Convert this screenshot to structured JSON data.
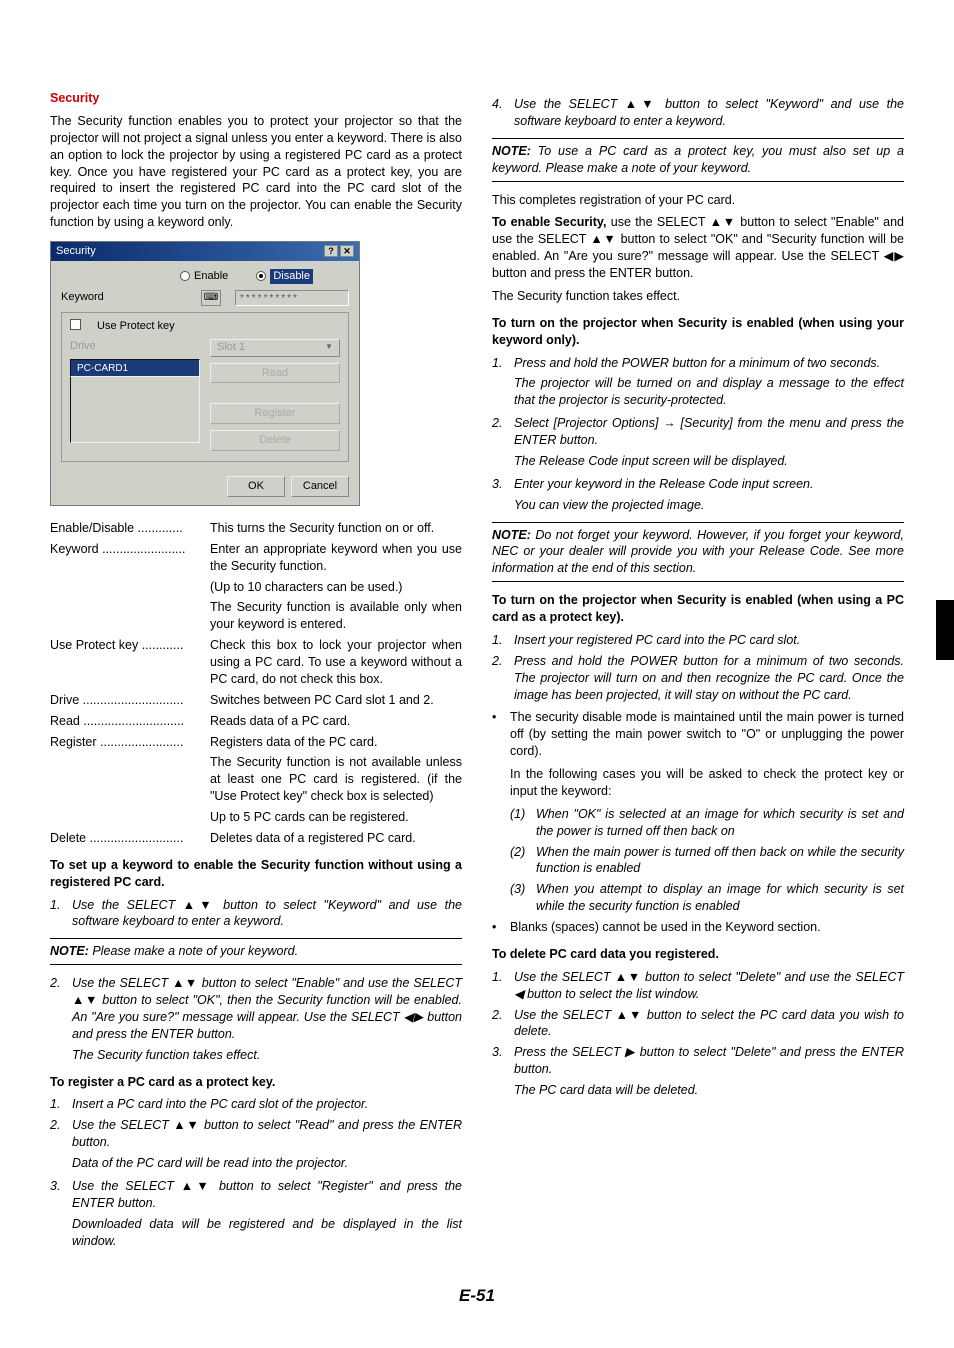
{
  "left": {
    "title": "Security",
    "intro": "The Security function enables you to protect your projector so that the projector will not project a signal unless you enter a keyword. There is also an option to lock the projector by using a registered PC card as a protect key. Once you have registered your PC card as a protect key, you are required to insert the registered PC card into the PC card slot of the projector each time you turn on the projector. You can enable the Security function by using a keyword only.",
    "dialog": {
      "title": "Security",
      "enable": "Enable",
      "disable": "Disable",
      "keyword": "Keyword",
      "kw_mask": "**********",
      "useprotect": "Use Protect key",
      "drive": "Drive",
      "slot": "Slot 1",
      "pccard": "PC-CARD1",
      "read": "Read",
      "register": "Register",
      "delete": "Delete",
      "ok": "OK",
      "cancel": "Cancel"
    },
    "defs": {
      "enable_t": "Enable/Disable .............",
      "enable_d": "This turns the Security function on or off.",
      "keyword_t": "Keyword ........................",
      "keyword_d": "Enter an appropriate keyword when you use the Security function.",
      "keyword_c1": "(Up to 10 characters can be used.)",
      "keyword_c2": "The Security function is available only when your keyword is entered.",
      "upk_t": "Use Protect key ............",
      "upk_d": "Check this box to lock your projector when using a PC card. To use a keyword without a PC card, do not check this box.",
      "drive_t": "Drive .............................",
      "drive_d": "Switches between PC Card slot 1 and 2.",
      "read_t": "Read .............................",
      "read_d": "Reads data of a PC card.",
      "reg_t": "Register ........................",
      "reg_d": "Registers data of the PC card.",
      "reg_c1": "The Security function is not available unless at least one PC card is registered. (if the \"Use Protect key\" check box is selected)",
      "reg_c2": "Up to 5 PC cards can be registered.",
      "del_t": "Delete ...........................",
      "del_d": "Deletes data of a registered PC card."
    },
    "setup_head": "To set up a keyword to enable the Security function without using a registered PC card.",
    "s1": "Use the SELECT ▲▼ button to select \"Keyword\" and use the software keyboard to enter a keyword.",
    "note1": "Please make a note of your keyword.",
    "s2a": "Use the SELECT ▲▼ button to select \"Enable\" and use the SELECT ▲▼ button to select \"OK\", then the Security function will be enabled. An \"Are you sure?\" message will appear. Use the SELECT ◀▶ button and press the ENTER button.",
    "s2b": "The Security function takes effect.",
    "reghead": "To register a PC card as a protect key.",
    "r1": "Insert a PC card into the PC card slot of the projector.",
    "r2": "Use the SELECT ▲▼ button to select \"Read\" and press the ENTER button.",
    "r2s": "Data of the PC card will be read into the projector.",
    "r3": "Use the SELECT ▲▼ button to select \"Register\" and press the ENTER button.",
    "r3s": "Downloaded data will be registered and be displayed in the list window."
  },
  "right": {
    "r4": "Use the SELECT ▲▼ button to select \"Keyword\" and use the software keyboard to enter a keyword.",
    "note2": "To use a PC card as a protect key, you must also set up a keyword. Please make a note of your keyword.",
    "completes": "This completes registration of your PC card.",
    "enable_para": "use the SELECT ▲▼ button and use the SELECT ▲▼ button to select \"OK\" and \"Security function will be enabled. An \"Are you sure?\" message will appear. Use the SELECT ◀▶ button and press the ENTER button.",
    "enable_lead": "To enable Security,",
    "enable_body1": " use the SELECT ▲▼ button to select \"Enable\" and use the SELECT ▲▼ button to select \"OK\" and \"Security function will be enabled. An \"Are you sure?\" message will appear. Use the SELECT ◀▶ button and press the ENTER button.",
    "enable_body2": "The Security function takes effect.",
    "turnon_kw_head": "To turn on the projector when Security is enabled (when using your keyword only).",
    "k1": "Press and hold the POWER button for a minimum of two seconds.",
    "k1s": "The projector will be turned on and display a message to the effect that the projector is security-protected.",
    "k2": "Select [Projector Options] → [Security] from the menu and press the ENTER button.",
    "k2s": "The Release Code input screen will be displayed.",
    "k3a": "Enter your keyword in the Release Code input screen.",
    "k3b": "You can view the projected image.",
    "note3": "Do not forget your keyword. However, if you forget your keyword, NEC or your dealer will provide you with your Release Code. See more information at the end of this section.",
    "turnon_pc_head": "To turn on the projector when Security is enabled (when using a PC card as a protect key).",
    "p1": "Insert your registered PC card into the PC card slot.",
    "p2": "Press and hold the POWER button for a minimum of two seconds. The projector will turn on and then recognize the PC card. Once the image has been projected, it will stay on without the PC card.",
    "b1": "The security disable mode is maintained until the main power is turned off (by setting the main power switch to \"O\" or unplugging the power cord).",
    "b1b": "In the following cases you will be asked to check the protect key or input the keyword:",
    "c1": "When \"OK\" is selected at an image for which security is set and the power is turned off then back on",
    "c2": "When the main power is turned off then back on while the security function is enabled",
    "c3": "When you attempt to display an image for which security is set while the security function is enabled",
    "b2": "Blanks (spaces) cannot be used in the Keyword section.",
    "delhead": "To delete PC card data you registered.",
    "d1": "Use the SELECT ▲▼ button to select \"Delete\" and use the SELECT ◀ button to select the list window.",
    "d2": "Use the SELECT ▲▼ button to select the PC card data you wish to delete.",
    "d3": "Press the SELECT ▶ button to select \"Delete\" and press the ENTER button.",
    "d3s": "The PC card data will be deleted."
  },
  "page": "E-51",
  "note_label": "NOTE:"
}
